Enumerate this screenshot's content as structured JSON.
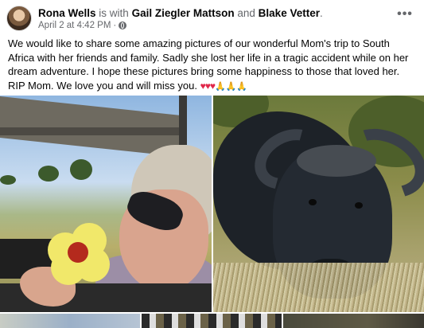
{
  "post": {
    "author": "Rona Wells",
    "with_text": "is with",
    "tagged_1": "Gail Ziegler Mattson",
    "and_text": "and",
    "tagged_2": "Blake Vetter",
    "trailing_dot": ".",
    "timestamp": "April 2 at 4:42 PM",
    "separator": "·",
    "privacy_icon": "globe-icon",
    "more_label": "•••",
    "text": "We would like to share some amazing pictures of our wonderful Mom's trip to South Africa with her friends and family. Sadly she lost her life in a tragic accident while on her dream adventure. I hope these pictures bring some happiness to those that loved her. RIP Mom. We love you and will miss you.",
    "emoji_hearts": "♥♥♥",
    "emoji_pray": "🙏🙏🙏"
  },
  "photos": [
    {
      "name": "safari-vehicle-photo",
      "icon": "photo"
    },
    {
      "name": "buffalo-photo",
      "icon": "photo"
    },
    {
      "name": "strip-photo-1",
      "icon": "photo"
    },
    {
      "name": "strip-photo-2",
      "icon": "photo"
    },
    {
      "name": "strip-photo-3",
      "icon": "photo"
    }
  ],
  "colors": {
    "name_text": "#050505",
    "secondary_text": "#65676b",
    "heart": "#e0284a",
    "background": "#ffffff"
  }
}
